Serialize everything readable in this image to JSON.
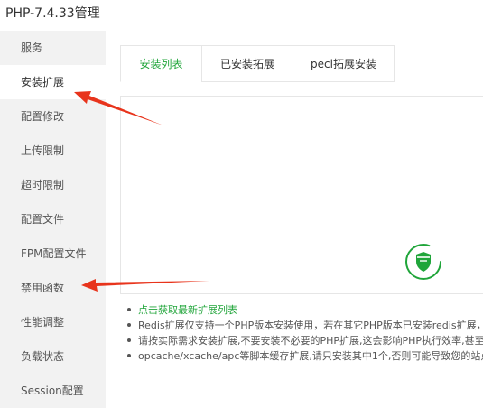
{
  "window": {
    "title": "PHP-7.4.33管理"
  },
  "sidebar": {
    "items": [
      {
        "label": "服务"
      },
      {
        "label": "安装扩展"
      },
      {
        "label": "配置修改"
      },
      {
        "label": "上传限制"
      },
      {
        "label": "超时限制"
      },
      {
        "label": "配置文件"
      },
      {
        "label": "FPM配置文件"
      },
      {
        "label": "禁用函数"
      },
      {
        "label": "性能调整"
      },
      {
        "label": "负载状态"
      },
      {
        "label": "Session配置"
      }
    ],
    "active_label": "安装扩展"
  },
  "tabs": [
    {
      "label": "安装列表"
    },
    {
      "label": "已安装拓展"
    },
    {
      "label": "pecl拓展安装"
    }
  ],
  "notes": {
    "refresh_link": "点击获取最新扩展列表",
    "items": [
      "Redis扩展仅支持一个PHP版本安装使用，若在其它PHP版本已安装redis扩展，请勿再装",
      "请按实际需求安装扩展,不要安装不必要的PHP扩展,这会影响PHP执行效率,甚至出现异常",
      "opcache/xcache/apc等脚本缓存扩展,请只安装其中1个,否则可能导致您的站点程序异常"
    ]
  },
  "colors": {
    "accent": "#20a53a",
    "arrow": "#e8341c",
    "sidebar_bg": "#f2f2f2"
  },
  "icons": {
    "loading": "loading-shield-icon",
    "annotation": "red-arrow-annotation"
  }
}
